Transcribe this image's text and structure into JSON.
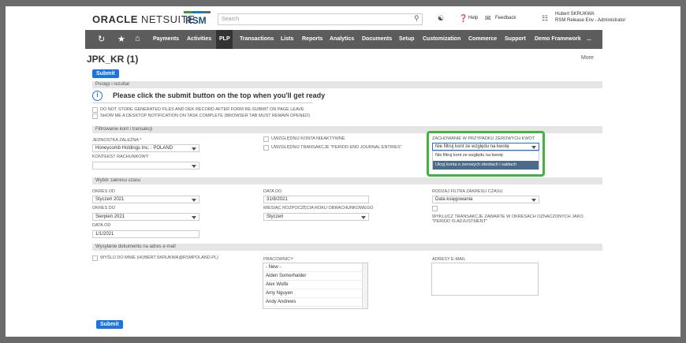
{
  "header": {
    "logo_brand": "ORACLE",
    "logo_product": " NETSUITE",
    "rsm_text": "RSM",
    "search_placeholder": "Search",
    "help": "Help",
    "feedback": "Feedback",
    "user_name": "Hubert SKRUKWA",
    "user_role": "RSM Release Env - Administrator"
  },
  "nav": {
    "items": [
      "Payments",
      "Activities",
      "PLP",
      "Transactions",
      "Lists",
      "Reports",
      "Analytics",
      "Documents",
      "Setup",
      "Customization",
      "Commerce",
      "Support",
      "Demo Framework",
      "..."
    ]
  },
  "page": {
    "title": "JPK_KR (1)",
    "more": "More",
    "submit_top": "Submit",
    "submit_bottom": "Submit"
  },
  "progress": {
    "section": "Postęp i rezultat",
    "info": "Please click the submit button on the top when you'll get ready",
    "cb1": "DO NOT STORE GENERATED FILES AND DEK RECORD AFTER FORM RE-SUBMIT OR PAGE LEAVE",
    "cb2": "SHOW ME A DESKTOP NOTIFICATION ON TASK COMPLETE (BROWSER TAB MUST REMAIN OPENED)"
  },
  "filters": {
    "section": "Filtrowanie kont i transakcji",
    "subsidiary_label": "JEDNOSTKA ZALEŻNA *",
    "subsidiary_value": "Honeycomb Holdings Inc. : POLAND",
    "context_label": "KONTEKST RACHUNKOWY",
    "context_value": "",
    "cb_inactive": "UWZGLĘDNIJ KONTA NIEAKTYWNE",
    "cb_period_end": "UWZGLĘDNIJ TRANSAKCJE \"PERIOD END JOURNAL ENTRIES\"",
    "zero_label": "ZACHOWANIE W PRZYPADKU ZEROWYCH KWOT",
    "zero_value": "Nie filtruj kont ze względu na kwotę",
    "zero_options": [
      "Nie filtruj kont ze względu na kwotę",
      "Ukryj konta o zerowych obrotach i saldach"
    ]
  },
  "period": {
    "section": "Wybór zakresu czasu",
    "from_label": "OKRES OD",
    "from_value": "Styczeń 2021",
    "to_label": "OKRES DO",
    "to_value": "Sierpień 2021",
    "date_from_label": "DATA OD",
    "date_from_value": "1/1/2021",
    "date_to_label": "DATA DO",
    "date_to_value": "31/8/2021",
    "fy_label": "MIESIĄC ROZPOCZĘCIA ROKU OBRACHUNKOWEGO",
    "fy_value": "Styczeń",
    "filter_type_label": "RODZAJ FILTRA ZAKRESU CZASU",
    "filter_type_value": "Data księgowania",
    "exclude_adj": "WYKLUCZ TRANSAKCJE ZAWARTE W OKRESACH OZNACZONYCH JAKO \"PERIOD IS ADJUSTMENT\""
  },
  "email": {
    "section": "Wysyłanie dokumentu na adres e-mail",
    "send_to_me": "WYŚLIJ DO MNIE (HUBERT.SKRUKWA@RSMPOLAND.PL)",
    "employees_label": "PRACOWNICY",
    "employees": [
      "- New -",
      "Aiden Somerhalder",
      "Alex Wolfe",
      "Amy Nguyen",
      "Andy Andrews"
    ],
    "address_label": "ADRESY E-MAIL"
  }
}
